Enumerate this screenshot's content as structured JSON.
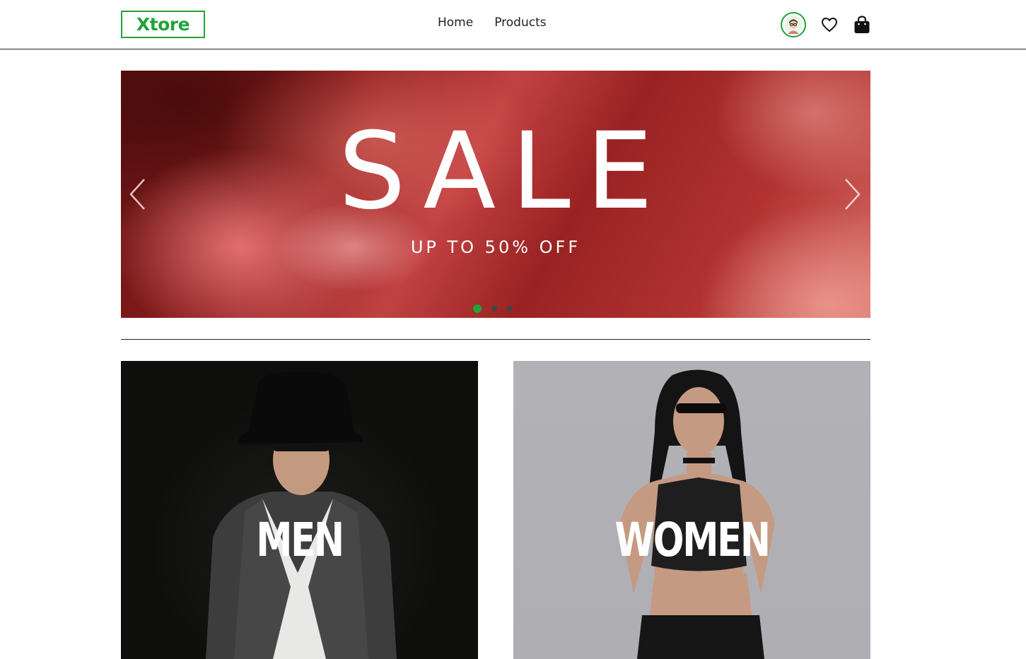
{
  "header": {
    "logo_text": "Xtore",
    "nav": [
      {
        "label": "Home"
      },
      {
        "label": "Products"
      }
    ],
    "icons": [
      "avatar",
      "heart-icon",
      "shopping-bag-icon"
    ]
  },
  "hero": {
    "title": "SALE",
    "subtitle": "UP TO 50% OFF",
    "slide_count": 3,
    "active_slide": 1
  },
  "categories": [
    {
      "label": "MEN"
    },
    {
      "label": "WOMEN"
    }
  ],
  "colors": {
    "accent": "#21a33a",
    "banner_red": "#9a2222",
    "text": "#222222"
  }
}
